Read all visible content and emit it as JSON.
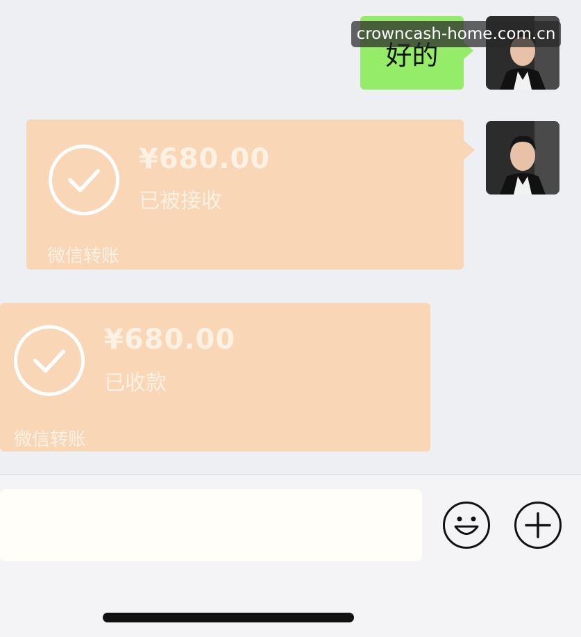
{
  "messages": {
    "text_reply": "好的",
    "transfer_sent": {
      "amount": "¥680.00",
      "status": "已被接收",
      "footer": "微信转账"
    },
    "transfer_received": {
      "amount": "¥680.00",
      "status": "已收款",
      "footer": "微信转账"
    }
  },
  "watermark": "crowncash-home.com.cn",
  "input_bar": {
    "emoji_icon": "emoji-icon",
    "plus_icon": "plus-icon"
  },
  "colors": {
    "chat_bg": "#edeff2",
    "text_bubble": "#95ec69",
    "transfer_bubble": "#f9d7b6"
  }
}
